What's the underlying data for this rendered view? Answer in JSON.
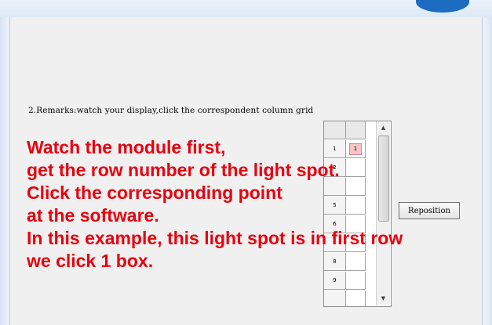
{
  "window": {
    "remarks_text": "2.Remarks:watch your display,click the correspondent column grid",
    "reposition_label": "Reposition"
  },
  "grid": {
    "rows": [
      {
        "row_label": "",
        "cell": ""
      },
      {
        "row_label": "1",
        "cell": "1",
        "selected": true
      },
      {
        "row_label": "2",
        "cell": ""
      },
      {
        "row_label": "",
        "cell": ""
      },
      {
        "row_label": "5",
        "cell": ""
      },
      {
        "row_label": "6",
        "cell": ""
      },
      {
        "row_label": "",
        "cell": ""
      },
      {
        "row_label": "8",
        "cell": ""
      },
      {
        "row_label": "9",
        "cell": ""
      },
      {
        "row_label": "",
        "cell": ""
      }
    ],
    "scroll_up_icon": "triangle-up",
    "scroll_down_icon": "triangle-down"
  },
  "annotation": {
    "lines": [
      "Watch the module first,",
      "get the row number of the light spot.",
      "Click the corresponding point",
      "at the software.",
      "In this example, this light spot is in first row",
      "we click 1 box."
    ],
    "color": "#e8000e"
  },
  "colors": {
    "window_bg": "#f0f0f0",
    "selected_cell": "#f7c5c9",
    "title_accent": "#1e6cc1"
  }
}
